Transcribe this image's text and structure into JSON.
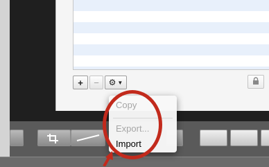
{
  "dialog": {
    "add_label": "+",
    "remove_label": "−",
    "gear_icon": "gear-icon",
    "chevron_icon": "chevron-down-icon",
    "lock_icon": "lock-icon"
  },
  "context_menu": {
    "items": [
      {
        "label": "Copy",
        "enabled": false
      },
      {
        "label": "Export...",
        "enabled": false
      },
      {
        "label": "Import",
        "enabled": true
      }
    ]
  },
  "annotation": {
    "color": "#c22a1c"
  }
}
